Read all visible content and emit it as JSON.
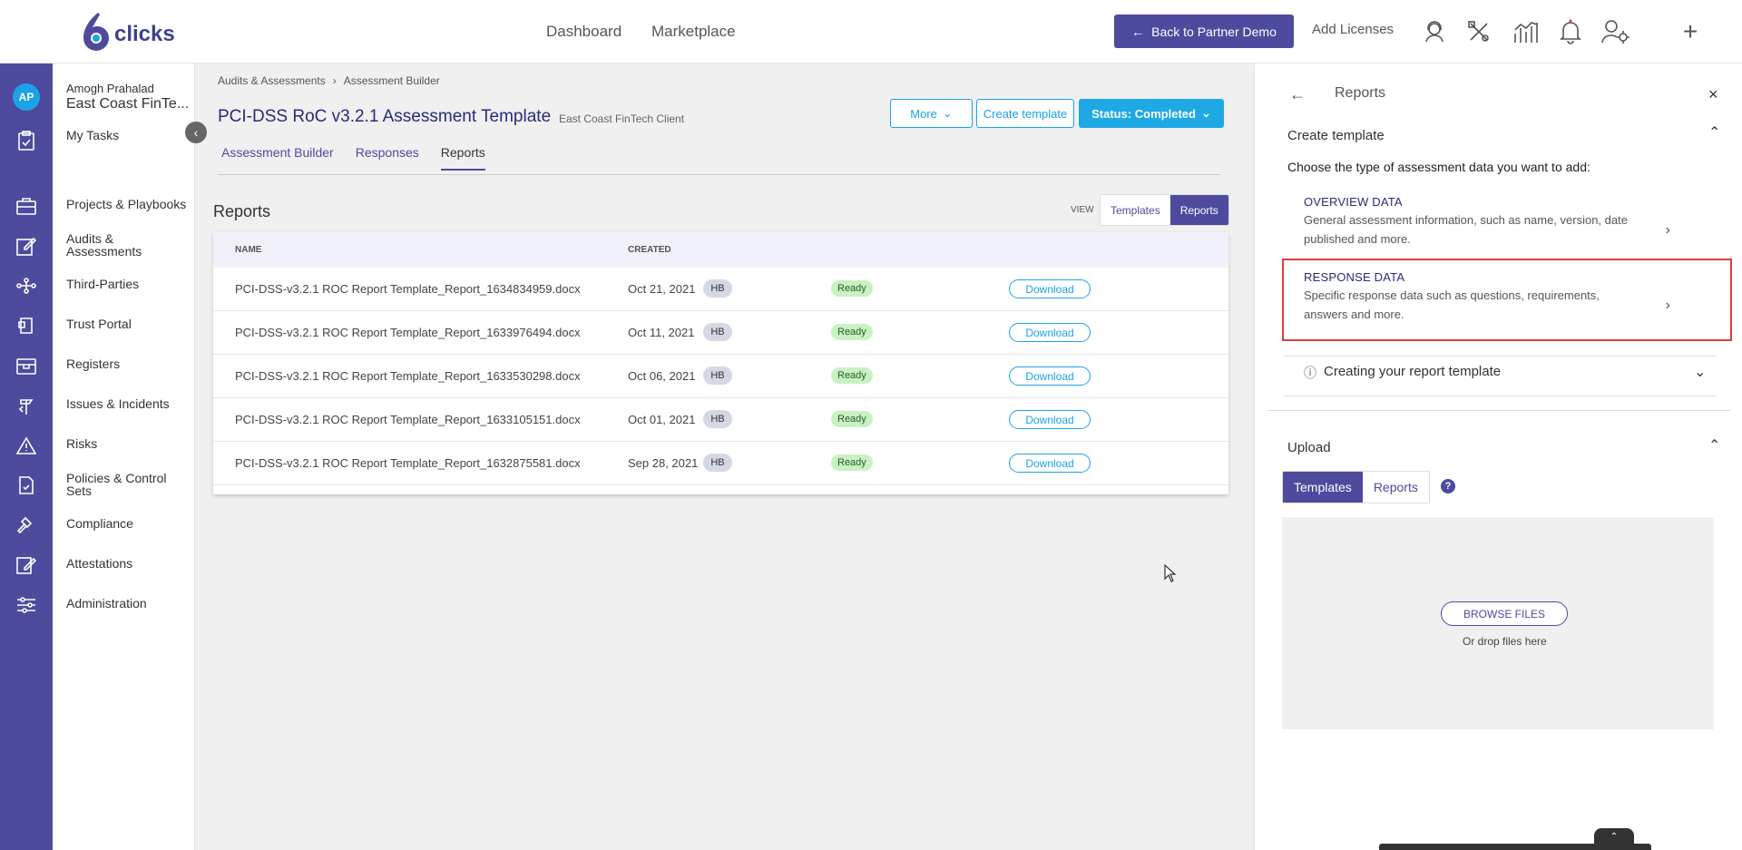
{
  "header": {
    "logo_text": "clicks",
    "nav": [
      "Dashboard",
      "Marketplace"
    ],
    "back_button": "Back to Partner Demo",
    "add_licenses": "Add Licenses",
    "icons": [
      "support-icon",
      "tools-icon",
      "analytics-icon",
      "bell-icon",
      "user-settings-icon",
      "plus-icon"
    ]
  },
  "rail": {
    "avatar": "AP",
    "icons": [
      "tasks-icon",
      "briefcase-icon",
      "edit-icon",
      "network-icon",
      "trust-icon",
      "register-icon",
      "signpost-icon",
      "warning-icon",
      "policy-icon",
      "gavel-icon",
      "attest-icon",
      "sliders-icon"
    ]
  },
  "sidebar": {
    "user_name": "Amogh Prahalad",
    "org_name": "East Coast FinTe...",
    "items": [
      "My Tasks",
      "Projects & Playbooks",
      "Audits & Assessments",
      "Third-Parties",
      "Trust Portal",
      "Registers",
      "Issues & Incidents",
      "Risks",
      "Policies & Control Sets",
      "Compliance",
      "Attestations",
      "Administration"
    ]
  },
  "main": {
    "breadcrumb": [
      "Audits & Assessments",
      "Assessment Builder"
    ],
    "title": "PCI-DSS RoC v3.2.1 Assessment Template",
    "client": "East Coast FinTech Client",
    "more_button": "More",
    "create_template_button": "Create template",
    "status_button": "Status: Completed",
    "tabs": [
      "Assessment Builder",
      "Responses",
      "Reports"
    ],
    "reports_title": "Reports",
    "view_label": "VIEW",
    "view_toggle": [
      "Templates",
      "Reports"
    ],
    "table": {
      "columns": [
        "NAME",
        "CREATED"
      ],
      "rows": [
        {
          "name": "PCI-DSS-v3.2.1 ROC Report Template_Report_1634834959.docx",
          "created": "Oct 21, 2021",
          "by": "HB",
          "status": "Ready",
          "action": "Download"
        },
        {
          "name": "PCI-DSS-v3.2.1 ROC Report Template_Report_1633976494.docx",
          "created": "Oct 11, 2021",
          "by": "HB",
          "status": "Ready",
          "action": "Download"
        },
        {
          "name": "PCI-DSS-v3.2.1 ROC Report Template_Report_1633530298.docx",
          "created": "Oct 06, 2021",
          "by": "HB",
          "status": "Ready",
          "action": "Download"
        },
        {
          "name": "PCI-DSS-v3.2.1 ROC Report Template_Report_1633105151.docx",
          "created": "Oct 01, 2021",
          "by": "HB",
          "status": "Ready",
          "action": "Download"
        },
        {
          "name": "PCI-DSS-v3.2.1 ROC Report Template_Report_1632875581.docx",
          "created": "Sep 28, 2021",
          "by": "HB",
          "status": "Ready",
          "action": "Download"
        }
      ]
    }
  },
  "panel": {
    "title": "Reports",
    "create_section": "Create template",
    "choose_text": "Choose the type of assessment data you want to add:",
    "overview": {
      "title": "OVERVIEW DATA",
      "desc": "General assessment information, such as name, version, date published and more."
    },
    "response": {
      "title": "RESPONSE DATA",
      "desc": "Specific response data such as questions, requirements, answers and more."
    },
    "creating_help": "Creating your report template",
    "upload_section": "Upload",
    "upload_tabs": [
      "Templates",
      "Reports"
    ],
    "browse_button": "BROWSE FILES",
    "drop_text": "Or drop files here"
  },
  "colors": {
    "brand": "#4e4a9e",
    "accent": "#1aa3e8",
    "highlight": "#e03c3c"
  }
}
